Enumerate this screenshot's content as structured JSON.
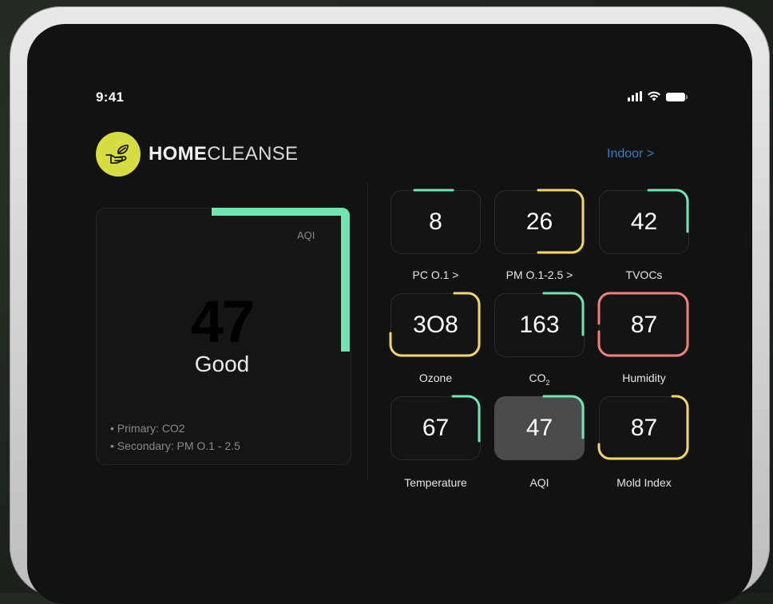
{
  "status_bar": {
    "time": "9:41"
  },
  "brand": {
    "name_bold": "HOME",
    "name_light": "CLEANSE",
    "logo_icon": "hand-leaf-icon"
  },
  "location": {
    "link": "Indoor >"
  },
  "aqi_card": {
    "label": "AQI",
    "value": "47",
    "status": "Good",
    "primary": "• Primary: CO2",
    "secondary": "• Secondary:  PM O.1 - 2.5",
    "accent_color": "#6fe5b0"
  },
  "colors": {
    "green": "#6fe5b0",
    "yellow": "#f2d56b",
    "red": "#f08078",
    "link": "#2f7fc4"
  },
  "metrics": [
    {
      "value": "8",
      "label": "PC O.1 >",
      "color": "green"
    },
    {
      "value": "26",
      "label": "PM O.1-2.5 >",
      "color": "yellow"
    },
    {
      "value": "42",
      "label": "TVOCs",
      "color": "green"
    },
    {
      "value": "3O8",
      "label": "Ozone",
      "color": "yellow"
    },
    {
      "value": "163",
      "label": "CO",
      "label_sub": "2",
      "color": "green"
    },
    {
      "value": "87",
      "label": "Humidity",
      "color": "red"
    },
    {
      "value": "67",
      "label": "Temperature",
      "color": "green"
    },
    {
      "value": "47",
      "label": "AQI",
      "color": "green",
      "selected": true
    },
    {
      "value": "87",
      "label": "Mold Index",
      "color": "yellow"
    }
  ]
}
